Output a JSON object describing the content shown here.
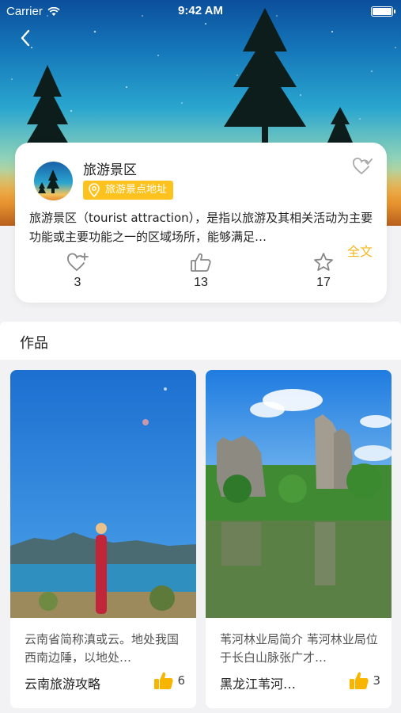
{
  "status_bar": {
    "carrier": "Carrier",
    "time": "9:42 AM"
  },
  "spot": {
    "name": "旅游景区",
    "address_tag": "旅游景点地址",
    "description": "旅游景区（tourist attraction），是指以旅游及其相关活动为主要功能或主要功能之一的区域场所，能够满足…",
    "full_text_label": "全文"
  },
  "stats": {
    "favorites": "3",
    "likes": "13",
    "stars": "17"
  },
  "works": {
    "section_title": "作品",
    "items": [
      {
        "description": "云南省简称滇或云。地处我国西南边陲，以地处…",
        "title": "云南旅游攻略",
        "likes": "6"
      },
      {
        "description": "苇河林业局简介 苇河林业局位于长白山脉张广才…",
        "title": "黑龙江苇河…",
        "likes": "3"
      }
    ]
  },
  "colors": {
    "accent": "#fdc21d",
    "link": "#f5b81c"
  },
  "icons": [
    "wifi-icon",
    "battery-icon",
    "back-icon",
    "favorite-add-icon",
    "location-pin-icon",
    "thumb-up-icon",
    "star-icon"
  ]
}
